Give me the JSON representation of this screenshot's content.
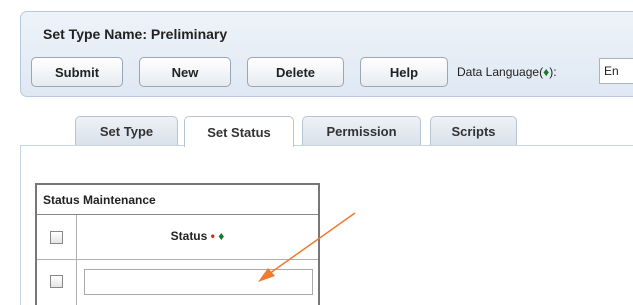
{
  "header": {
    "set_type_name": "Set Type Name: Preliminary",
    "buttons": {
      "submit": "Submit",
      "new": "New",
      "delete": "Delete",
      "help": "Help"
    },
    "data_language_label": "Data Language(",
    "data_language_marker": "♦",
    "data_language_suffix": "):",
    "data_language_value": "En"
  },
  "tabs": [
    {
      "label": "Set Type"
    },
    {
      "label": "Set Status"
    },
    {
      "label": "Permission"
    },
    {
      "label": "Scripts"
    }
  ],
  "active_tab": "Set Status",
  "status_maintenance": {
    "title": "Status Maintenance",
    "column_status": "Status",
    "required_marker": "•",
    "language_marker": "♦",
    "rows": [
      {
        "status": ""
      }
    ]
  },
  "colors": {
    "required": "#dd2222",
    "language_marker": "#1a7a2a",
    "annotation_arrow": "#f07a30"
  }
}
